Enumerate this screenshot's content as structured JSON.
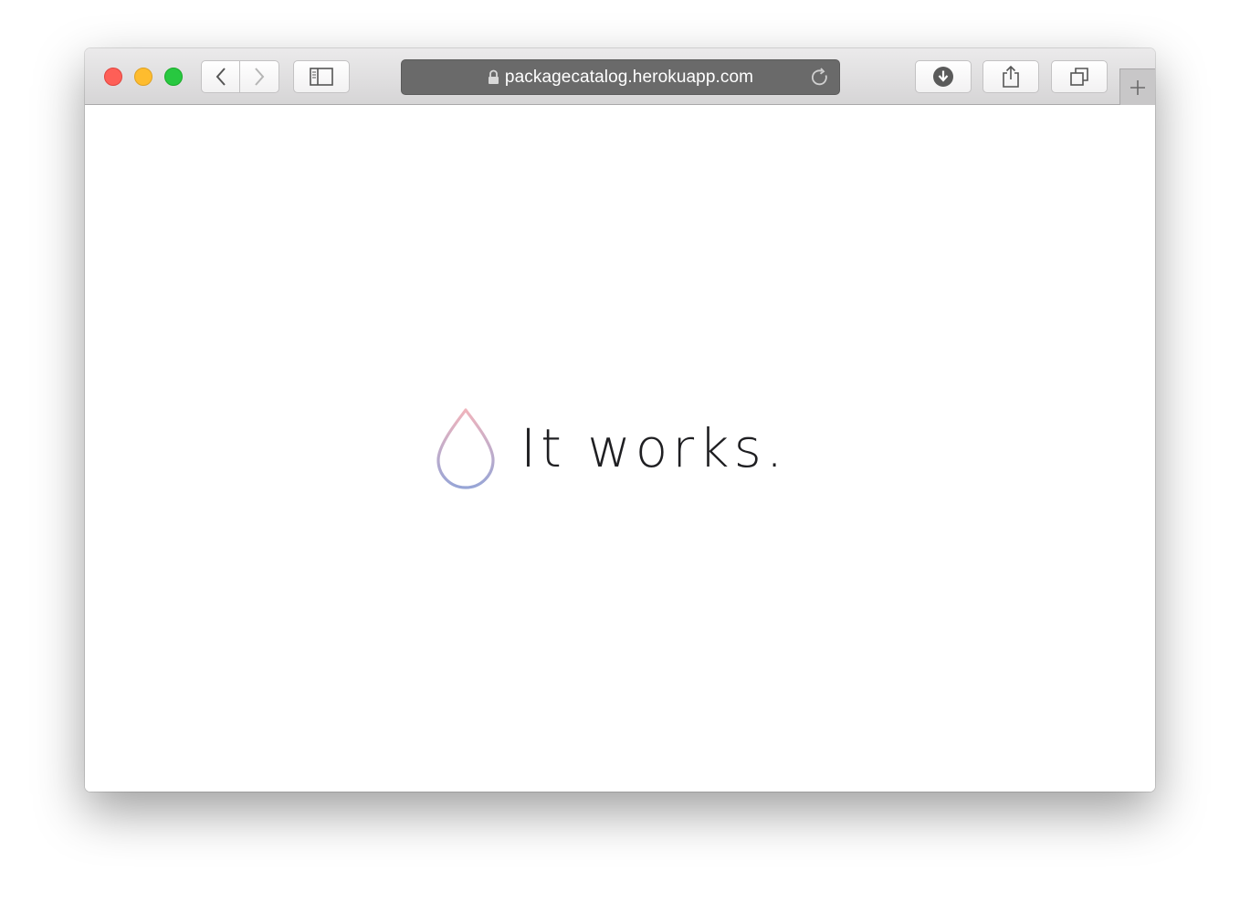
{
  "browser": {
    "address_bar": {
      "url": "packagecatalog.herokuapp.com",
      "secure": true
    },
    "icons": {
      "close": "close-traffic-light",
      "minimize": "minimize-traffic-light",
      "zoom": "zoom-traffic-light",
      "back": "chevron-left-icon",
      "forward": "chevron-right-icon",
      "sidebar": "sidebar-icon",
      "lock": "lock-icon",
      "reload": "reload-icon",
      "downloads": "download-icon",
      "share": "share-icon",
      "tabs": "tab-overview-icon",
      "new_tab": "plus-icon"
    },
    "colors": {
      "close": "#fe5f57",
      "minimize": "#febc2e",
      "zoom": "#28c840",
      "address_bar": "#6a6a6a"
    }
  },
  "page": {
    "headline": "It works.",
    "logo": "droplet-icon"
  }
}
